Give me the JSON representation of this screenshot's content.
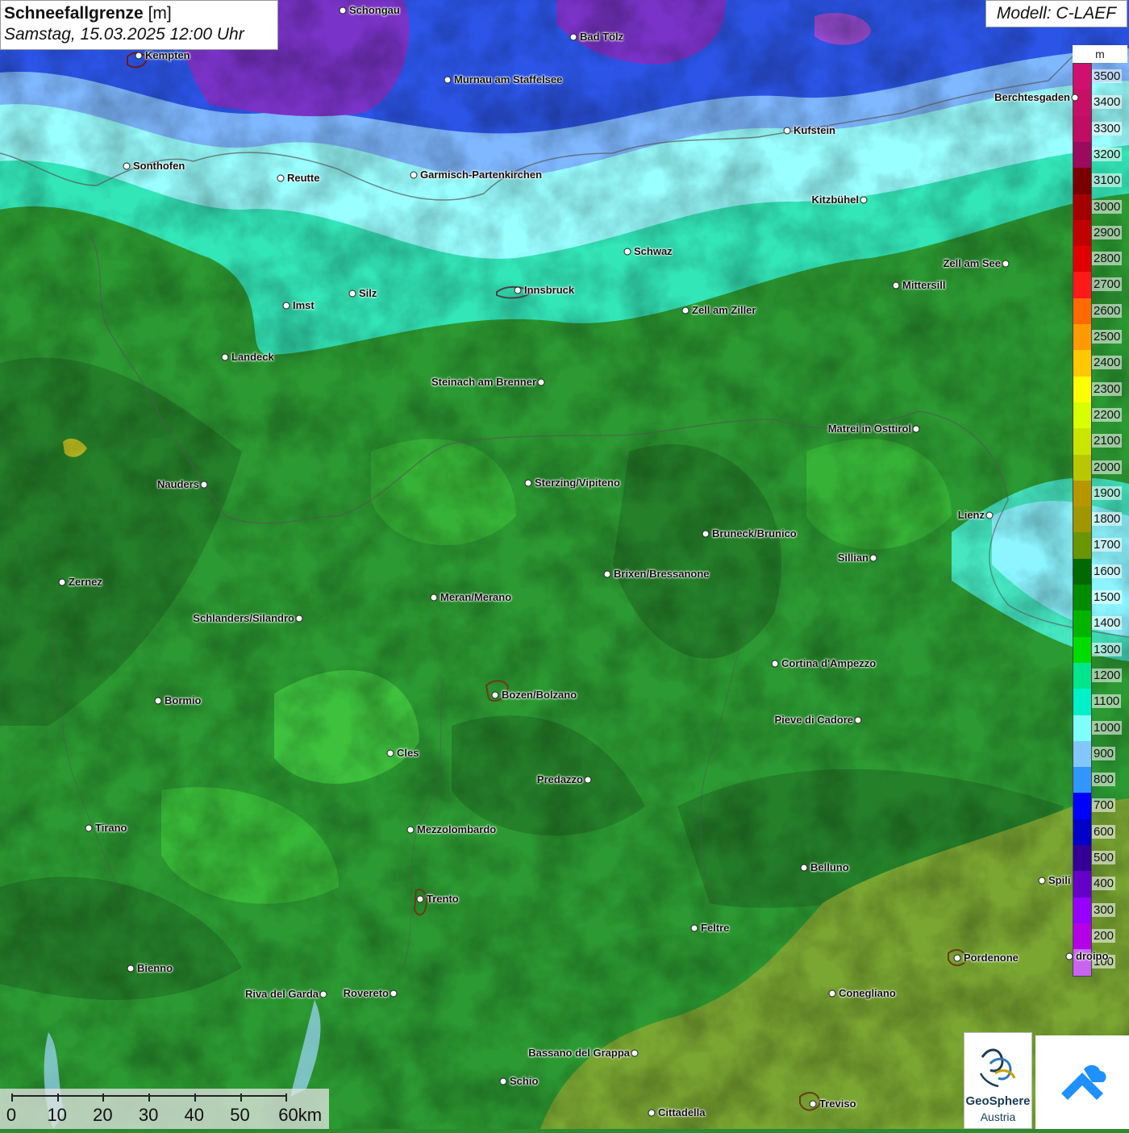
{
  "header": {
    "title_bold": "Schneefallgrenze",
    "title_unit": "[m]",
    "subtitle": "Samstag, 15.03.2025 12:00 Uhr",
    "model": "Modell: C-LAEF"
  },
  "legend": {
    "unit": "m",
    "steps": [
      {
        "label": "3500",
        "color": "#d0106e"
      },
      {
        "label": "3400",
        "color": "#c80f66"
      },
      {
        "label": "3300",
        "color": "#bf0d63"
      },
      {
        "label": "3200",
        "color": "#9a0a5e"
      },
      {
        "label": "3100",
        "color": "#7a0000"
      },
      {
        "label": "3000",
        "color": "#a50000"
      },
      {
        "label": "2900",
        "color": "#c10000"
      },
      {
        "label": "2800",
        "color": "#e00000"
      },
      {
        "label": "2700",
        "color": "#ff1a1a"
      },
      {
        "label": "2600",
        "color": "#ff6a00"
      },
      {
        "label": "2500",
        "color": "#ff9a00"
      },
      {
        "label": "2400",
        "color": "#ffc800"
      },
      {
        "label": "2300",
        "color": "#ffff00"
      },
      {
        "label": "2200",
        "color": "#d8ff00"
      },
      {
        "label": "2100",
        "color": "#c8e600"
      },
      {
        "label": "2000",
        "color": "#b8c800"
      },
      {
        "label": "1900",
        "color": "#b89600"
      },
      {
        "label": "1800",
        "color": "#a09600"
      },
      {
        "label": "1700",
        "color": "#6a9600"
      },
      {
        "label": "1600",
        "color": "#006a00"
      },
      {
        "label": "1500",
        "color": "#008c00"
      },
      {
        "label": "1400",
        "color": "#00b400"
      },
      {
        "label": "1300",
        "color": "#00dc00"
      },
      {
        "label": "1200",
        "color": "#00e68c"
      },
      {
        "label": "1100",
        "color": "#00f0c8"
      },
      {
        "label": "1000",
        "color": "#80ffff"
      },
      {
        "label": "900",
        "color": "#80c8ff"
      },
      {
        "label": "800",
        "color": "#3296ff"
      },
      {
        "label": "700",
        "color": "#0000ff"
      },
      {
        "label": "600",
        "color": "#0000c8"
      },
      {
        "label": "500",
        "color": "#320096"
      },
      {
        "label": "400",
        "color": "#6400c8"
      },
      {
        "label": "300",
        "color": "#9600ff"
      },
      {
        "label": "200",
        "color": "#b400e6"
      },
      {
        "label": "100",
        "color": "#c864f0"
      }
    ]
  },
  "cities": [
    {
      "name": "Schongau",
      "side": "right"
    },
    {
      "name": "Bad Tölz",
      "side": "right"
    },
    {
      "name": "Kempten",
      "side": "right"
    },
    {
      "name": "Murnau am Staffelsee",
      "side": "right"
    },
    {
      "name": "Berchtesgaden",
      "side": "left"
    },
    {
      "name": "Kufstein",
      "side": "right"
    },
    {
      "name": "Sonthofen",
      "side": "right"
    },
    {
      "name": "Reutte",
      "side": "right"
    },
    {
      "name": "Garmisch-Partenkirchen",
      "side": "right"
    },
    {
      "name": "Kitzbühel",
      "side": "left"
    },
    {
      "name": "Schwaz",
      "side": "right"
    },
    {
      "name": "Zell am See",
      "side": "left"
    },
    {
      "name": "Mittersill",
      "side": "right"
    },
    {
      "name": "Innsbruck",
      "side": "right"
    },
    {
      "name": "Imst",
      "side": "right"
    },
    {
      "name": "Silz",
      "side": "right"
    },
    {
      "name": "Zell am Ziller",
      "side": "right"
    },
    {
      "name": "Landeck",
      "side": "right"
    },
    {
      "name": "Steinach am Brenner",
      "side": "left"
    },
    {
      "name": "Matrei in Osttirol",
      "side": "left"
    },
    {
      "name": "Nauders",
      "side": "left"
    },
    {
      "name": "Sterzing/Vipiteno",
      "side": "right"
    },
    {
      "name": "Lienz",
      "side": "left"
    },
    {
      "name": "Bruneck/Brunico",
      "side": "right"
    },
    {
      "name": "Sillian",
      "side": "left"
    },
    {
      "name": "Zernez",
      "side": "right"
    },
    {
      "name": "Brixen/Bressanone",
      "side": "right"
    },
    {
      "name": "Meran/Merano",
      "side": "right"
    },
    {
      "name": "Schlanders/Silandro",
      "side": "left"
    },
    {
      "name": "Cortina d'Ampezzo",
      "side": "right"
    },
    {
      "name": "Bormio",
      "side": "right"
    },
    {
      "name": "Bozen/Bolzano",
      "side": "right"
    },
    {
      "name": "Pieve di Cadore",
      "side": "left"
    },
    {
      "name": "Cles",
      "side": "right"
    },
    {
      "name": "Predazzo",
      "side": "left"
    },
    {
      "name": "Tirano",
      "side": "right"
    },
    {
      "name": "Mezzolombardo",
      "side": "right"
    },
    {
      "name": "Belluno",
      "side": "right"
    },
    {
      "name": "Spili",
      "side": "right"
    },
    {
      "name": "Trento",
      "side": "right"
    },
    {
      "name": "Feltre",
      "side": "right"
    },
    {
      "name": "Pordenone",
      "side": "right"
    },
    {
      "name": "droipo",
      "side": "right"
    },
    {
      "name": "Bienno",
      "side": "right"
    },
    {
      "name": "Riva del Garda",
      "side": "left"
    },
    {
      "name": "Rovereto",
      "side": "left"
    },
    {
      "name": "Conegliano",
      "side": "right"
    },
    {
      "name": "Bassano del Grappa",
      "side": "left"
    },
    {
      "name": "Schio",
      "side": "right"
    },
    {
      "name": "Treviso",
      "side": "right"
    },
    {
      "name": "Cittadella",
      "side": "right"
    }
  ],
  "scale": {
    "labels": [
      "0",
      "10",
      "20",
      "30",
      "40",
      "50",
      "60km"
    ]
  },
  "logos": {
    "geosphere_name": "GeoSphere",
    "geosphere_sub": "Austria"
  }
}
